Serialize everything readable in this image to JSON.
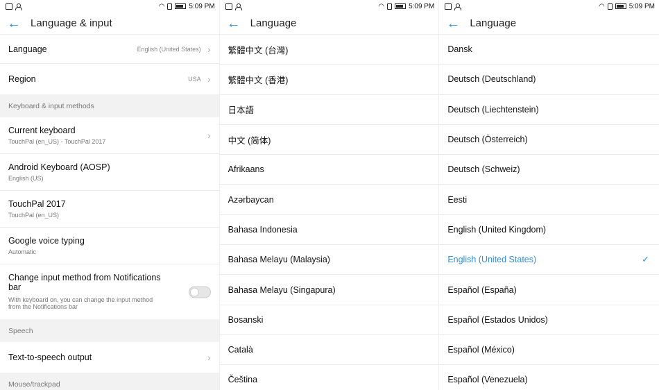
{
  "status": {
    "time": "5:09 PM"
  },
  "panel1": {
    "title": "Language & input",
    "language": {
      "label": "Language",
      "value": "English (United States)"
    },
    "region": {
      "label": "Region",
      "value": "USA"
    },
    "sec_keyboard": "Keyboard & input methods",
    "current_keyboard": {
      "label": "Current keyboard",
      "sub": "TouchPal (en_US) - TouchPal 2017"
    },
    "aosp": {
      "label": "Android Keyboard (AOSP)",
      "sub": "English (US)"
    },
    "touchpal": {
      "label": "TouchPal 2017",
      "sub": "TouchPal (en_US)"
    },
    "gvt": {
      "label": "Google voice typing",
      "sub": "Automatic"
    },
    "change_input": {
      "label": "Change input method from Notifications bar",
      "sub": "With keyboard on, you can change the input method from the Notifications bar",
      "toggle": false
    },
    "sec_speech": "Speech",
    "tts": {
      "label": "Text-to-speech output"
    },
    "sec_mouse": "Mouse/trackpad"
  },
  "panel2": {
    "title": "Language",
    "items": [
      "繁體中文 (台灣)",
      "繁體中文 (香港)",
      "日本語",
      "中文 (简体)",
      "Afrikaans",
      "Azərbaycan",
      "Bahasa Indonesia",
      "Bahasa Melayu (Malaysia)",
      "Bahasa Melayu (Singapura)",
      "Bosanski",
      "Català",
      "Čeština"
    ]
  },
  "panel3": {
    "title": "Language",
    "items": [
      "Dansk",
      "Deutsch (Deutschland)",
      "Deutsch (Liechtenstein)",
      "Deutsch (Österreich)",
      "Deutsch (Schweiz)",
      "Eesti",
      "English (United Kingdom)",
      "English (United States)",
      "Español (España)",
      "Español (Estados Unidos)",
      "Español (México)",
      "Español (Venezuela)"
    ],
    "selected_index": 7
  },
  "colors": {
    "accent": "#2f8ee0"
  }
}
